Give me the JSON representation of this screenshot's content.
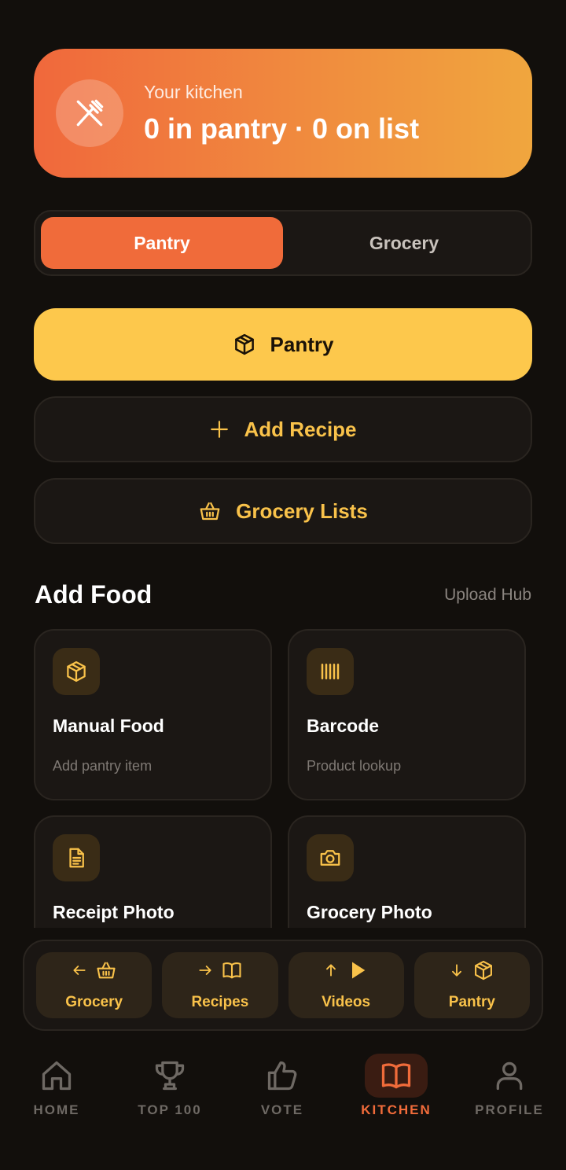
{
  "kitchen": {
    "subtitle": "Your kitchen",
    "summary": "0 in pantry · 0 on list",
    "icon": "utensils-crossed-icon"
  },
  "tabs": [
    {
      "label": "Pantry",
      "active": true
    },
    {
      "label": "Grocery",
      "active": false
    }
  ],
  "actions": {
    "pantry": {
      "label": "Pantry",
      "icon": "box-icon"
    },
    "add_recipe": {
      "label": "Add Recipe",
      "icon": "plus-icon"
    },
    "grocery_lists": {
      "label": "Grocery Lists",
      "icon": "basket-icon"
    }
  },
  "add_food": {
    "title": "Add Food",
    "link": "Upload Hub",
    "cards": [
      {
        "title": "Manual Food",
        "subtitle": "Add pantry item",
        "icon": "box-icon"
      },
      {
        "title": "Barcode",
        "subtitle": "Product lookup",
        "icon": "barcode-icon"
      },
      {
        "title": "Receipt Photo",
        "subtitle": "",
        "icon": "receipt-icon"
      },
      {
        "title": "Grocery Photo",
        "subtitle": "",
        "icon": "camera-icon"
      }
    ]
  },
  "quick": [
    {
      "label": "Grocery",
      "icons": [
        "arrow-left-icon",
        "basket-icon"
      ]
    },
    {
      "label": "Recipes",
      "icons": [
        "arrow-right-icon",
        "book-icon"
      ]
    },
    {
      "label": "Videos",
      "icons": [
        "arrow-up-icon",
        "play-icon"
      ]
    },
    {
      "label": "Pantry",
      "icons": [
        "arrow-down-icon",
        "box-icon"
      ]
    }
  ],
  "nav": [
    {
      "label": "HOME",
      "icon": "home-icon",
      "active": false
    },
    {
      "label": "TOP 100",
      "icon": "trophy-icon",
      "active": false
    },
    {
      "label": "VOTE",
      "icon": "thumbs-up-icon",
      "active": false
    },
    {
      "label": "KITCHEN",
      "icon": "book-icon",
      "active": true
    },
    {
      "label": "PROFILE",
      "icon": "user-icon",
      "active": false
    }
  ],
  "colors": {
    "background": "#120f0c",
    "accent": "#f06b3a",
    "primary_button": "#fdc84c",
    "gold_text": "#f9c24a"
  }
}
